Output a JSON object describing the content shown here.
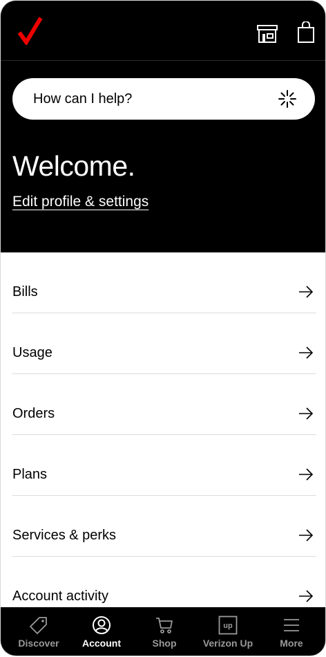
{
  "brand": {
    "accent": "#ee0000"
  },
  "topbar": {
    "icons": [
      "store-icon",
      "shopping-bag-icon"
    ]
  },
  "search": {
    "placeholder": "How can I help?",
    "icon": "sparkle-icon"
  },
  "welcome": {
    "title": "Welcome.",
    "edit_link": "Edit profile & settings"
  },
  "menu": {
    "items": [
      {
        "label": "Bills"
      },
      {
        "label": "Usage"
      },
      {
        "label": "Orders"
      },
      {
        "label": "Plans"
      },
      {
        "label": "Services & perks"
      },
      {
        "label": "Account activity"
      }
    ]
  },
  "tabbar": {
    "tabs": [
      {
        "label": "Discover",
        "icon": "tag-icon",
        "active": false
      },
      {
        "label": "Account",
        "icon": "account-circle-icon",
        "active": true
      },
      {
        "label": "Shop",
        "icon": "cart-icon",
        "active": false
      },
      {
        "label": "Verizon Up",
        "icon": "up-icon",
        "active": false
      },
      {
        "label": "More",
        "icon": "menu-icon",
        "active": false
      }
    ]
  }
}
